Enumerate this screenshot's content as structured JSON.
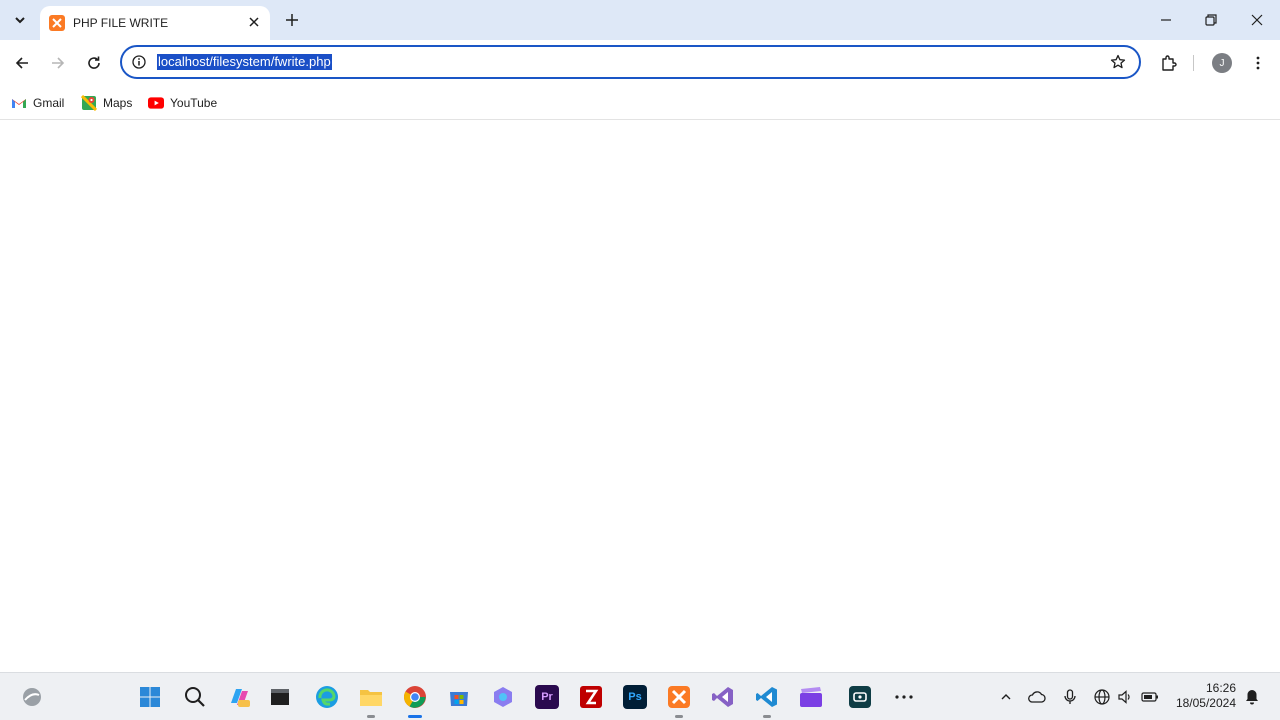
{
  "browser": {
    "tab": {
      "title": "PHP FILE WRITE"
    },
    "address_bar": {
      "url": "localhost/filesystem/fwrite.php"
    },
    "profile": {
      "initial": "J"
    },
    "bookmarks": [
      {
        "label": "Gmail",
        "icon": "gmail-icon"
      },
      {
        "label": "Maps",
        "icon": "maps-icon"
      },
      {
        "label": "YouTube",
        "icon": "youtube-icon"
      }
    ]
  },
  "taskbar": {
    "apps": [
      {
        "name": "widgets",
        "icon": "widgets-icon"
      },
      {
        "name": "start",
        "icon": "windows-start-icon"
      },
      {
        "name": "search",
        "icon": "search-icon"
      },
      {
        "name": "copilot",
        "icon": "copilot-icon"
      },
      {
        "name": "terminal",
        "icon": "terminal-icon"
      },
      {
        "name": "edge",
        "icon": "edge-icon"
      },
      {
        "name": "file-explorer",
        "icon": "folder-icon"
      },
      {
        "name": "chrome",
        "icon": "chrome-icon"
      },
      {
        "name": "store",
        "icon": "store-icon"
      },
      {
        "name": "photos",
        "icon": "photos-icon"
      },
      {
        "name": "premiere",
        "icon": "premiere-icon",
        "label": "Pr"
      },
      {
        "name": "filezilla",
        "icon": "filezilla-icon"
      },
      {
        "name": "photoshop",
        "icon": "photoshop-icon",
        "label": "Ps"
      },
      {
        "name": "xampp",
        "icon": "xampp-icon"
      },
      {
        "name": "visual-studio",
        "icon": "visual-studio-icon"
      },
      {
        "name": "vscode",
        "icon": "vscode-icon"
      },
      {
        "name": "clipchamp",
        "icon": "clipchamp-icon"
      },
      {
        "name": "screen-recorder",
        "icon": "recorder-icon"
      },
      {
        "name": "more",
        "icon": "more-icon"
      }
    ],
    "clock": {
      "time": "16:26",
      "date": "18/05/2024"
    }
  },
  "colors": {
    "tabstrip": "#dee8f7",
    "accent": "#1a56c6",
    "url_selection": "#1a4fc7",
    "taskbar": "#eef0f3"
  }
}
